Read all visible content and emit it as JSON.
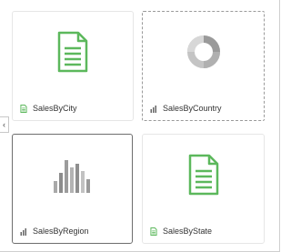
{
  "colors": {
    "doc_green": "#5cb85c",
    "chart_gray": "#8f8f8f",
    "text": "#333333"
  },
  "panel": {
    "collapse_glyph": "‹",
    "tiles": [
      {
        "label": "SalesByCity",
        "kind": "document",
        "thumb_icon": "document-icon",
        "small_icon": "document-small-icon"
      },
      {
        "label": "SalesByCountry",
        "kind": "chart",
        "thumb_icon": "donut-chart-icon",
        "small_icon": "bar-chart-small-icon",
        "state": "dashed"
      },
      {
        "label": "SalesByRegion",
        "kind": "chart",
        "thumb_icon": "bar-chart-icon",
        "small_icon": "bar-chart-small-icon",
        "state": "selected"
      },
      {
        "label": "SalesByState",
        "kind": "document",
        "thumb_icon": "document-icon",
        "small_icon": "document-small-icon"
      }
    ]
  }
}
